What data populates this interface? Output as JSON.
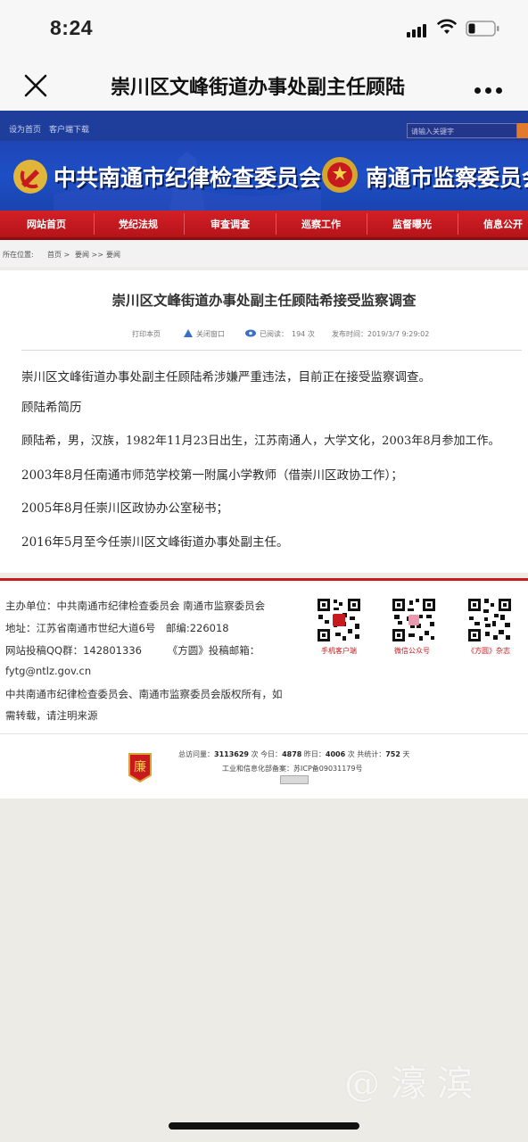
{
  "status_bar": {
    "time": "8:24"
  },
  "nav": {
    "title": "崇川区文峰街道办事处副主任顾陆"
  },
  "site": {
    "top_links": [
      "设为首页",
      "客户端下载"
    ],
    "search_placeholder": "请输入关键字",
    "banner_left": "中共南通市纪律检查委员会",
    "banner_right": "南通市监察委员会",
    "menu": [
      "网站首页",
      "党纪法规",
      "审查调查",
      "巡察工作",
      "监督曝光",
      "信息公开"
    ],
    "breadcrumb": {
      "label": "所在位置:",
      "home": "首页 >",
      "cat": "要闻 >>",
      "current": "要闻"
    }
  },
  "article": {
    "title": "崇川区文峰街道办事处副主任顾陆希接受监察调查",
    "print": "打印本页",
    "close": "关闭窗口",
    "read_label": "已阅读：",
    "read_count": "194 次",
    "publish_time": "发布时间：2019/3/7 9:29:02",
    "paragraphs": [
      "崇川区文峰街道办事处副主任顾陆希涉嫌严重违法，目前正在接受监察调查。",
      "顾陆希简历",
      "顾陆希，男，汉族，1982年11月23日出生，江苏南通人，大学文化，2003年8月参加工作。",
      "2003年8月任南通市师范学校第一附属小学教师（借崇川区政协工作）；",
      "2005年8月任崇川区政协办公室秘书；",
      "2016年5月至今任崇川区文峰街道办事处副主任。"
    ]
  },
  "footer": {
    "lines": [
      "主办单位：中共南通市纪律检查委员会 南通市监察委员会",
      "地址：江苏省南通市世纪大道6号　邮编:226018",
      "网站投稿QQ群：142801336　　　《方圆》投稿邮箱：",
      "fytg@ntlz.gov.cn",
      "中共南通市纪律检查委员会、南通市监察委员会版权所有，如",
      "需转载，请注明来源"
    ],
    "qr_labels": [
      "手机客户端",
      "微信公众号",
      "《方圆》杂志"
    ],
    "stats": {
      "total_label": "总访问量：",
      "total": "3113629",
      "unit": "次",
      "today_label": "今日：",
      "today": "4878",
      "yesterday_label": "昨日：",
      "yesterday": "4006",
      "days_label": "共统计：",
      "days": "752",
      "days_unit": "天",
      "icp": "工业和信息化部备案：苏ICP备09031179号"
    }
  },
  "watermark": "@濠滨",
  "colors": {
    "banner_blue": "#1f45b6",
    "menu_red": "#c8191f"
  }
}
